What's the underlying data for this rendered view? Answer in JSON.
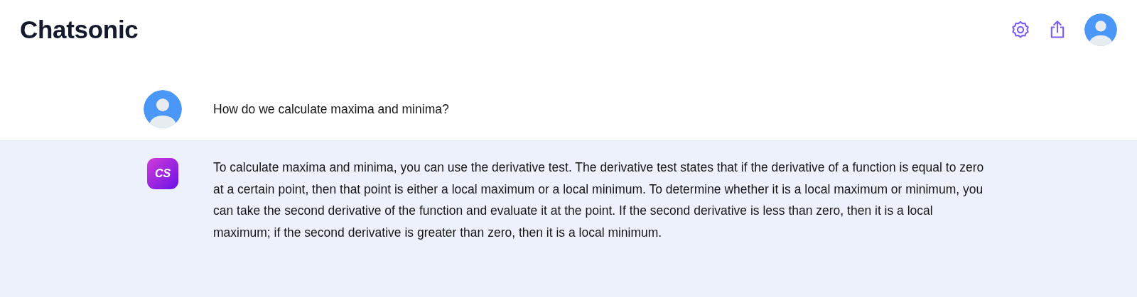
{
  "header": {
    "title": "Chatsonic"
  },
  "messages": [
    {
      "kind": "user",
      "text": "How do we calculate maxima and minima?"
    },
    {
      "kind": "bot",
      "logo_text": "CS",
      "text": "To calculate maxima and minima, you can use the derivative test. The derivative test states that if the derivative of a function is equal to zero at a certain point, then that point is either a local maximum or a local minimum. To determine whether it is a local maximum or minimum, you can take the second derivative of the function and evaluate it at the point. If the second derivative is less than zero, then it is a local maximum; if the second derivative is greater than zero, then it is a local minimum."
    }
  ]
}
